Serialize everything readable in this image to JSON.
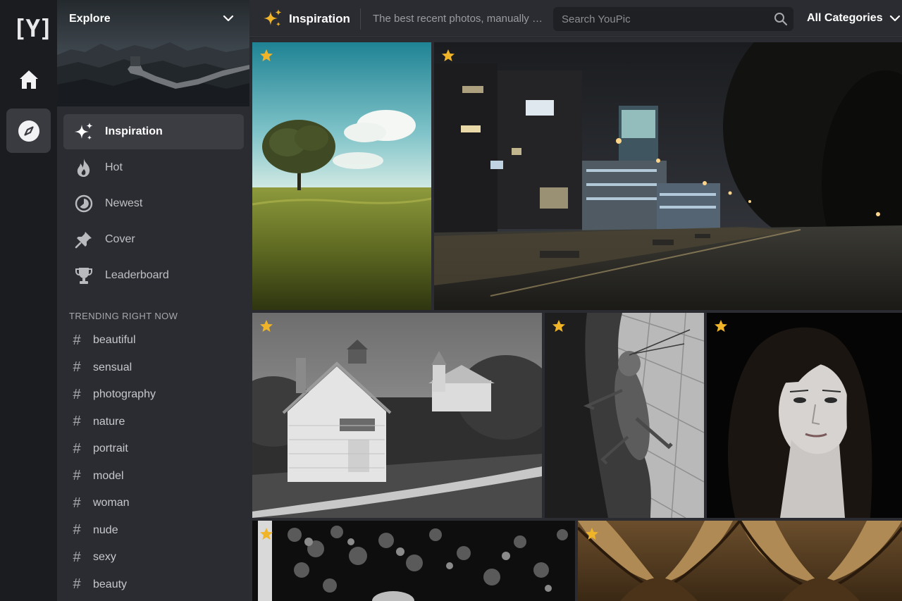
{
  "app": {
    "logo_text": "[Y]"
  },
  "rail": {
    "items": [
      {
        "name": "home",
        "icon": "home-icon"
      },
      {
        "name": "explore",
        "icon": "compass-icon",
        "active": true
      }
    ]
  },
  "sidebar": {
    "section_title": "Explore",
    "menu": [
      {
        "label": "Inspiration",
        "icon": "sparkles-icon",
        "active": true
      },
      {
        "label": "Hot",
        "icon": "flame-icon"
      },
      {
        "label": "Newest",
        "icon": "clock-icon"
      },
      {
        "label": "Cover",
        "icon": "pin-icon"
      },
      {
        "label": "Leaderboard",
        "icon": "trophy-icon"
      }
    ],
    "trending_heading": "TRENDING RIGHT NOW",
    "tags": [
      "beautiful",
      "sensual",
      "photography",
      "nature",
      "portrait",
      "model",
      "woman",
      "nude",
      "sexy",
      "beauty"
    ]
  },
  "topbar": {
    "title": "Inspiration",
    "description": "The best recent photos, manually selected",
    "search_placeholder": "Search YouPic",
    "category": "All Categories"
  },
  "colors": {
    "star": "#f0b429",
    "active_bg": "#3c3d43",
    "sidebar_bg": "#2b2c31",
    "rail_bg": "#1b1c20"
  },
  "photos": [
    {
      "name": "photo-tree-field",
      "featured": true
    },
    {
      "name": "photo-night-street",
      "featured": true
    },
    {
      "name": "photo-white-church",
      "featured": true
    },
    {
      "name": "photo-grasshopper",
      "featured": true
    },
    {
      "name": "photo-woman-portrait",
      "featured": true
    },
    {
      "name": "photo-foliage-bw",
      "featured": true
    },
    {
      "name": "photo-vaulted-ceiling",
      "featured": true
    }
  ]
}
